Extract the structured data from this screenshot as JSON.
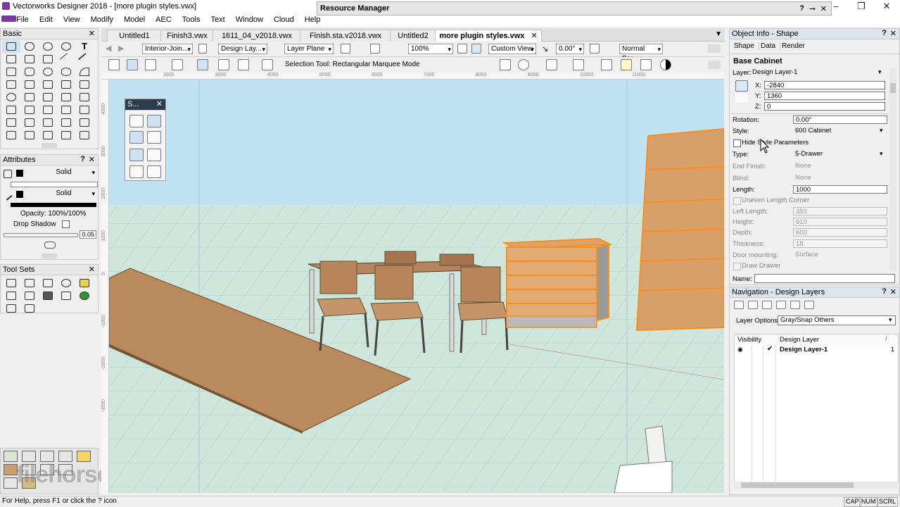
{
  "window": {
    "title": "Vectorworks Designer 2018 - [more plugin styles.vwx]",
    "controls": [
      "–",
      "❐",
      "✕"
    ]
  },
  "menu": [
    "File",
    "Edit",
    "View",
    "Modify",
    "Model",
    "AEC",
    "Tools",
    "Text",
    "Window",
    "Cloud",
    "Help"
  ],
  "resource_manager": {
    "title": "Resource Manager",
    "help": "?",
    "pin": "⊸",
    "close": "✕"
  },
  "palettes": {
    "basic": {
      "title": "Basic",
      "close": "✕"
    },
    "attributes": {
      "title": "Attributes",
      "help": "?",
      "close": "✕",
      "fill_label": "Solid",
      "pen_label": "Solid",
      "opacity": "Opacity: 100%/100%",
      "drop_shadow": "Drop Shadow",
      "line_weight": "0.05"
    },
    "tool_sets": {
      "title": "Tool Sets",
      "close": "✕"
    },
    "snapping": {
      "title": "S...",
      "close": "✕"
    }
  },
  "tabs": [
    {
      "label": "Untitled1"
    },
    {
      "label": "Finish3.vwx"
    },
    {
      "label": "1611_04_v2018.vwx"
    },
    {
      "label": "Finish.sta.v2018.vwx"
    },
    {
      "label": "Untitled2"
    },
    {
      "label": "more plugin styles.vwx",
      "active": true
    }
  ],
  "tab_close": "✕",
  "view_bar": {
    "class": "Interior-Join...",
    "layer": "Design Lay...",
    "plane": "Layer Plane",
    "zoom": "100%",
    "view": "Custom View",
    "angle": "0.00°",
    "render": "Normal Per..."
  },
  "tool_bar": {
    "mode_text": "Selection Tool: Rectangular Marquee Mode"
  },
  "rulers": {
    "h": [
      "2000",
      "3000",
      "4000",
      "5000",
      "6000",
      "7000",
      "8000",
      "9000",
      "10000",
      "11000"
    ],
    "v": [
      "4000",
      "3000",
      "2000",
      "1000",
      "0",
      "-1000",
      "-2000",
      "-3000"
    ]
  },
  "object_info": {
    "title": "Object Info - Shape",
    "help": "?",
    "close": "✕",
    "tabs": [
      "Shape",
      "Data",
      "Render"
    ],
    "object_type": "Base Cabinet",
    "layer_label": "Layer:",
    "layer_value": "Design Layer-1",
    "x_label": "X:",
    "x_value": "-2840",
    "y_label": "Y:",
    "y_value": "1360",
    "z_label": "Z:",
    "z_value": "0",
    "rotation_label": "Rotation:",
    "rotation_value": "0.00°",
    "style_label": "Style:",
    "style_value": "600 Cabinet",
    "hide_style_label": "Hide Style Parameters",
    "type_label": "Type:",
    "type_value": "5-Drawer",
    "end_finish_label": "End Finish:",
    "end_finish_value": "None",
    "blind_label": "Blind:",
    "blind_value": "None",
    "length_label": "Length:",
    "length_value": "1000",
    "uneven_label": "Uneven Length Corner",
    "left_length_label": "Left Length:",
    "left_length_value": "350",
    "height_label": "Height:",
    "height_value": "910",
    "depth_label": "Depth:",
    "depth_value": "600",
    "thickness_label": "Thickness:",
    "thickness_value": "18",
    "door_mount_label": "Door mounting:",
    "door_mount_value": "Surface",
    "draw_drawer_label": "Draw Drawer",
    "name_label": "Name:"
  },
  "navigation": {
    "title": "Navigation - Design Layers",
    "help": "?",
    "close": "✕",
    "layer_options_label": "Layer Options:",
    "layer_options_value": "Gray/Snap Others",
    "col_visibility": "Visibility",
    "col_design_layer": "Design Layer",
    "rows": [
      {
        "name": "Design Layer-1",
        "check": "✔",
        "num": "1"
      }
    ]
  },
  "status": {
    "help_text": "For Help, press F1 or click the ? icon",
    "cap": "CAP",
    "num": "NUM",
    "scrl": "SCRL"
  },
  "colors": {
    "ground": "#cfe6dc",
    "sky": "#bfe3f3",
    "wood": "#c9a27a",
    "highlight": "#ff8c1a",
    "panel_bg": "#f0f0f0"
  },
  "watermark": "filehorse.com"
}
